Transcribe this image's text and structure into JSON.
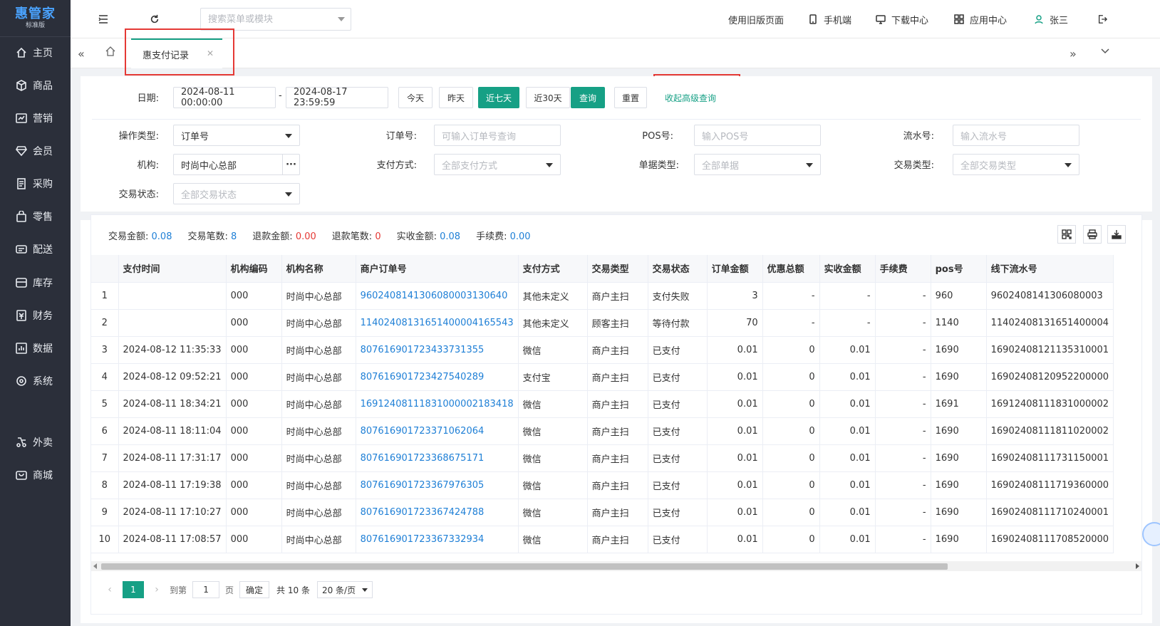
{
  "brand": {
    "name": "惠管家",
    "edition": "标准版"
  },
  "sidebar": {
    "items": [
      {
        "label": "主页",
        "icon": "home-icon"
      },
      {
        "label": "商品",
        "icon": "box-icon"
      },
      {
        "label": "营销",
        "icon": "chart-icon"
      },
      {
        "label": "会员",
        "icon": "diamond-icon"
      },
      {
        "label": "采购",
        "icon": "purchase-icon"
      },
      {
        "label": "零售",
        "icon": "bag-icon"
      },
      {
        "label": "配送",
        "icon": "delivery-icon"
      },
      {
        "label": "库存",
        "icon": "storage-icon"
      },
      {
        "label": "财务",
        "icon": "finance-icon"
      },
      {
        "label": "数据",
        "icon": "data-icon"
      },
      {
        "label": "系统",
        "icon": "system-icon"
      },
      {
        "label": "外卖",
        "icon": "takeout-icon"
      },
      {
        "label": "商城",
        "icon": "mall-icon"
      }
    ]
  },
  "header": {
    "search_placeholder": "搜索菜单或模块",
    "links": {
      "old_version": "使用旧版页面",
      "mobile": "手机端",
      "download": "下载中心",
      "apps": "应用中心",
      "user": "张三"
    }
  },
  "tabs": {
    "active": "惠支付记录"
  },
  "filters": {
    "date_label": "日期:",
    "date_start": "2024-08-11 00:00:00",
    "date_sep": "-",
    "date_end": "2024-08-17 23:59:59",
    "quick": {
      "today": "今天",
      "yesterday": "昨天",
      "last7": "近七天",
      "last30": "近30天"
    },
    "query_btn": "查询",
    "reset_btn": "重置",
    "advanced_link": "收起高级查询",
    "op_type_label": "操作类型:",
    "op_type_value": "订单号",
    "order_no_label": "订单号:",
    "order_no_placeholder": "可输入订单号查询",
    "pos_label": "POS号:",
    "pos_placeholder": "输入POS号",
    "serial_label": "流水号:",
    "serial_placeholder": "输入流水号",
    "org_label": "机构:",
    "org_value": "时尚中心总部",
    "org_more": "···",
    "pay_method_label": "支付方式:",
    "pay_method_value": "全部支付方式",
    "doc_type_label": "单据类型:",
    "doc_type_value": "全部单据",
    "trade_type_label": "交易类型:",
    "trade_type_value": "全部交易类型",
    "trade_status_label": "交易状态:",
    "trade_status_value": "全部交易状态"
  },
  "summary": {
    "amount_label": "交易金额:",
    "amount": "0.08",
    "count_label": "交易笔数:",
    "count": "8",
    "refund_amount_label": "退款金额:",
    "refund_amount": "0.00",
    "refund_count_label": "退款笔数:",
    "refund_count": "0",
    "actual_label": "实收金额:",
    "actual": "0.08",
    "fee_label": "手续费:",
    "fee": "0.00"
  },
  "table": {
    "columns": [
      "",
      "支付时间",
      "机构编码",
      "机构名称",
      "商户订单号",
      "支付方式",
      "交易类型",
      "交易状态",
      "订单金额",
      "优惠总额",
      "实收金额",
      "手续费",
      "pos号",
      "线下流水号"
    ],
    "rows": [
      [
        "1",
        "",
        "000",
        "时尚中心总部",
        "96024081413060800031306​40",
        "其他未定义",
        "商户主扫",
        "支付失败",
        "3",
        "-",
        "-",
        "-",
        "960",
        "9602408141306080003"
      ],
      [
        "2",
        "",
        "000",
        "时尚中心总部",
        "114024081316514000041655​43",
        "其他未定义",
        "顾客主扫",
        "等待付款",
        "70",
        "-",
        "-",
        "-",
        "1140",
        "11402408131651400004"
      ],
      [
        "3",
        "2024-08-12 11:35:33",
        "000",
        "时尚中心总部",
        "807616901723433731355",
        "微信",
        "商户主扫",
        "已支付",
        "0.01",
        "0",
        "0.01",
        "-",
        "1690",
        "16902408121135310001"
      ],
      [
        "4",
        "2024-08-12 09:52:21",
        "000",
        "时尚中心总部",
        "807616901723427540289",
        "支付宝",
        "商户主扫",
        "已支付",
        "0.01",
        "0",
        "0.01",
        "-",
        "1690",
        "16902408120952200000"
      ],
      [
        "5",
        "2024-08-11 18:34:21",
        "000",
        "时尚中心总部",
        "169124081118310000021834​18",
        "微信",
        "商户主扫",
        "已支付",
        "0.01",
        "0",
        "0.01",
        "-",
        "1691",
        "16912408111831000002"
      ],
      [
        "6",
        "2024-08-11 18:11:04",
        "000",
        "时尚中心总部",
        "807616901723371062064",
        "微信",
        "商户主扫",
        "已支付",
        "0.01",
        "0",
        "0.01",
        "-",
        "1690",
        "16902408111811020002"
      ],
      [
        "7",
        "2024-08-11 17:31:17",
        "000",
        "时尚中心总部",
        "807616901723368675171",
        "微信",
        "商户主扫",
        "已支付",
        "0.01",
        "0",
        "0.01",
        "-",
        "1690",
        "16902408111731150001"
      ],
      [
        "8",
        "2024-08-11 17:19:38",
        "000",
        "时尚中心总部",
        "807616901723367976305",
        "微信",
        "商户主扫",
        "已支付",
        "0.01",
        "0",
        "0.01",
        "-",
        "1690",
        "16902408111719360000"
      ],
      [
        "9",
        "2024-08-11 17:10:27",
        "000",
        "时尚中心总部",
        "807616901723367424788",
        "微信",
        "商户主扫",
        "已支付",
        "0.01",
        "0",
        "0.01",
        "-",
        "1690",
        "16902408111710240001"
      ],
      [
        "10",
        "2024-08-11 17:08:57",
        "000",
        "时尚中心总部",
        "807616901723367332934",
        "微信",
        "商户主扫",
        "已支付",
        "0.01",
        "0",
        "0.01",
        "-",
        "1690",
        "16902408111708520000"
      ]
    ]
  },
  "pager": {
    "current": "1",
    "goto_label": "到第",
    "goto_value": "1",
    "page_unit": "页",
    "confirm": "确定",
    "total": "共 10 条",
    "page_size": "20 条/页"
  }
}
